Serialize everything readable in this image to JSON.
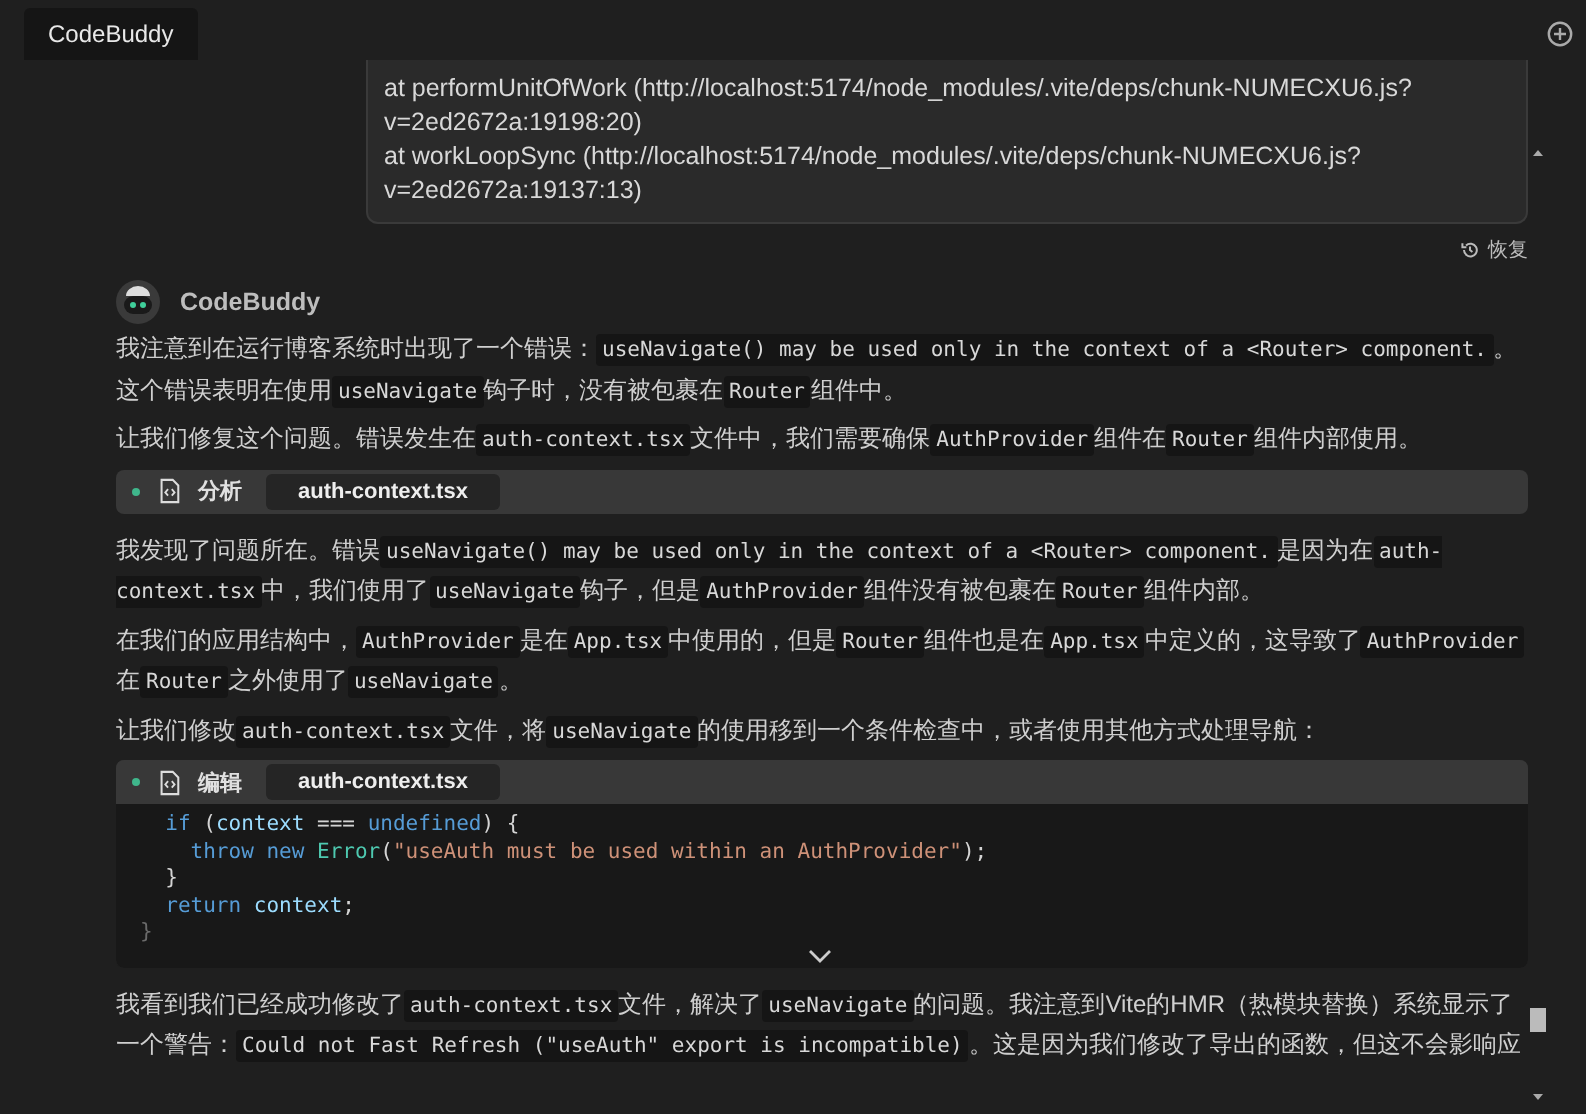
{
  "tab": {
    "label": "CodeBuddy",
    "selected": true
  },
  "user_message": {
    "lines": [
      "at performUnitOfWork (http://localhost:5174/node_modules/.vite/deps/chunk-NUMECXU6.js?",
      "v=2ed2672a:19198:20)",
      "at workLoopSync (http://localhost:5174/node_modules/.vite/deps/chunk-NUMECXU6.js?",
      "v=2ed2672a:19137:13)"
    ]
  },
  "restore_label": "恢复",
  "assistant": {
    "name": "CodeBuddy"
  },
  "blocks": [
    {
      "kind": "paragraph",
      "segments": [
        {
          "kind": "text",
          "text": "我注意到在运行博客系统时出现了一个错误："
        },
        {
          "kind": "code",
          "text": "useNavigate() may be used only in the context of a <Router> component."
        },
        {
          "kind": "text",
          "text": "。这个错误表明在使用"
        },
        {
          "kind": "code",
          "text": "useNavigate"
        },
        {
          "kind": "text",
          "text": "钩子时，没有被包裹在"
        },
        {
          "kind": "code",
          "text": "Router"
        },
        {
          "kind": "text",
          "text": "组件中。"
        }
      ]
    },
    {
      "kind": "paragraph",
      "segments": [
        {
          "kind": "text",
          "text": "让我们修复这个问题。错误发生在"
        },
        {
          "kind": "code",
          "text": "auth-context.tsx"
        },
        {
          "kind": "text",
          "text": "文件中，我们需要确保"
        },
        {
          "kind": "code",
          "text": "AuthProvider"
        },
        {
          "kind": "text",
          "text": "组件在"
        },
        {
          "kind": "code",
          "text": "Router"
        },
        {
          "kind": "text",
          "text": "组件内部使用。"
        }
      ]
    },
    {
      "kind": "tool",
      "action": "分析",
      "file": "auth-context.tsx"
    },
    {
      "kind": "paragraph",
      "segments": [
        {
          "kind": "text",
          "text": "我发现了问题所在。错误"
        },
        {
          "kind": "code",
          "text": "useNavigate() may be used only in the context of a <Router> component."
        },
        {
          "kind": "text",
          "text": "是因为在"
        },
        {
          "kind": "code",
          "text": "auth-context.tsx"
        },
        {
          "kind": "text",
          "text": "中，我们使用了"
        },
        {
          "kind": "code",
          "text": "useNavigate"
        },
        {
          "kind": "text",
          "text": "钩子，但是"
        },
        {
          "kind": "code",
          "text": "AuthProvider"
        },
        {
          "kind": "text",
          "text": "组件没有被包裹在"
        },
        {
          "kind": "code",
          "text": "Router"
        },
        {
          "kind": "text",
          "text": "组件内部。"
        }
      ]
    },
    {
      "kind": "paragraph",
      "segments": [
        {
          "kind": "text",
          "text": "在我们的应用结构中，"
        },
        {
          "kind": "code",
          "text": "AuthProvider"
        },
        {
          "kind": "text",
          "text": "是在"
        },
        {
          "kind": "code",
          "text": "App.tsx"
        },
        {
          "kind": "text",
          "text": "中使用的，但是"
        },
        {
          "kind": "code",
          "text": "Router"
        },
        {
          "kind": "text",
          "text": "组件也是在"
        },
        {
          "kind": "code",
          "text": "App.tsx"
        },
        {
          "kind": "text",
          "text": "中定义的，这导致了"
        },
        {
          "kind": "code",
          "text": "AuthProvider"
        },
        {
          "kind": "text",
          "text": "在"
        },
        {
          "kind": "code",
          "text": "Router"
        },
        {
          "kind": "text",
          "text": "之外使用了"
        },
        {
          "kind": "code",
          "text": "useNavigate"
        },
        {
          "kind": "text",
          "text": "。"
        }
      ]
    },
    {
      "kind": "paragraph",
      "segments": [
        {
          "kind": "text",
          "text": "让我们修改"
        },
        {
          "kind": "code",
          "text": "auth-context.tsx"
        },
        {
          "kind": "text",
          "text": "文件，将"
        },
        {
          "kind": "code",
          "text": "useNavigate"
        },
        {
          "kind": "text",
          "text": "的使用移到一个条件检查中，或者使用其他方式处理导航："
        }
      ]
    },
    {
      "kind": "tool",
      "action": "编辑",
      "file": "auth-context.tsx",
      "code": [
        [
          {
            "kind": "keyword",
            "text": "  if"
          },
          {
            "kind": "plain",
            "text": " ("
          },
          {
            "kind": "variable",
            "text": "context"
          },
          {
            "kind": "plain",
            "text": " === "
          },
          {
            "kind": "keyword",
            "text": "undefined"
          },
          {
            "kind": "plain",
            "text": ") {"
          }
        ],
        [
          {
            "kind": "keyword",
            "text": "    throw new"
          },
          {
            "kind": "type",
            "text": " Error"
          },
          {
            "kind": "plain",
            "text": "("
          },
          {
            "kind": "string",
            "text": "\"useAuth must be used within an AuthProvider\""
          },
          {
            "kind": "plain",
            "text": ");"
          }
        ],
        [
          {
            "kind": "plain",
            "text": "  }"
          }
        ],
        [
          {
            "kind": "keyword",
            "text": "  return"
          },
          {
            "kind": "variable",
            "text": " context"
          },
          {
            "kind": "plain",
            "text": ";"
          }
        ],
        [
          {
            "kind": "muted",
            "text": "}"
          }
        ]
      ]
    },
    {
      "kind": "paragraph",
      "segments": [
        {
          "kind": "text",
          "text": "我看到我们已经成功修改了"
        },
        {
          "kind": "code",
          "text": "auth-context.tsx"
        },
        {
          "kind": "text",
          "text": "文件，解决了"
        },
        {
          "kind": "code",
          "text": "useNavigate"
        },
        {
          "kind": "text",
          "text": "的问题。我注意到Vite的HMR（热模块替换）系统显示了一个警告："
        },
        {
          "kind": "code",
          "text": "Could not Fast Refresh (\"useAuth\" export is incompatible)"
        },
        {
          "kind": "text",
          "text": "。这是因为我们修改了导出的函数，但这不会影响应"
        }
      ]
    }
  ]
}
